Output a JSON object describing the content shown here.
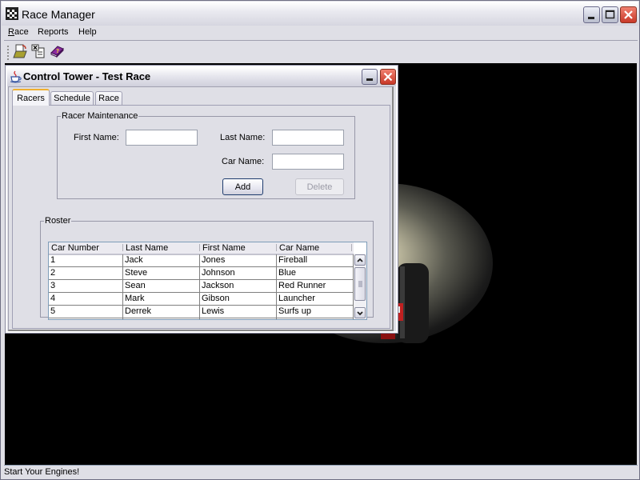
{
  "app": {
    "title": "Race Manager",
    "menu": [
      {
        "label": "Race",
        "mnemonic": "R"
      },
      {
        "label": "Reports"
      },
      {
        "label": "Help"
      }
    ],
    "toolbar": [
      {
        "icon": "open-folder-icon",
        "tooltip": "Open"
      },
      {
        "icon": "close-document-icon",
        "tooltip": "Close"
      },
      {
        "icon": "help-book-icon",
        "tooltip": "Help"
      }
    ],
    "status": "Start Your Engines!",
    "window_buttons": {
      "minimize": "minimize",
      "maximize": "maximize",
      "close": "close"
    }
  },
  "internal_frame": {
    "title": "Control Tower - Test Race",
    "tabs": [
      {
        "label": "Racers",
        "active": true
      },
      {
        "label": "Schedule",
        "active": false
      },
      {
        "label": "Race",
        "active": false
      }
    ],
    "racer_maintenance": {
      "legend": "Racer Maintenance",
      "first_name_label": "First Name:",
      "first_name_value": "",
      "last_name_label": "Last Name:",
      "last_name_value": "",
      "car_name_label": "Car Name:",
      "car_name_value": "",
      "add_label": "Add",
      "delete_label": "Delete",
      "delete_enabled": false
    },
    "roster": {
      "legend": "Roster",
      "columns": [
        "Car Number",
        "Last Name",
        "First Name",
        "Car Name"
      ],
      "rows": [
        [
          "1",
          "Jack",
          "Jones",
          "Fireball"
        ],
        [
          "2",
          "Steve",
          "Johnson",
          "Blue"
        ],
        [
          "3",
          "Sean",
          "Jackson",
          "Red Runner"
        ],
        [
          "4",
          "Mark",
          "Gibson",
          "Launcher"
        ],
        [
          "5",
          "Derrek",
          "Lewis",
          "Surfs up"
        ],
        [
          "",
          "",
          "",
          ""
        ]
      ]
    }
  },
  "colors": {
    "active_tab_accent": "#f0b030",
    "close_button": "#d04030",
    "desktop_background": "#000000"
  }
}
